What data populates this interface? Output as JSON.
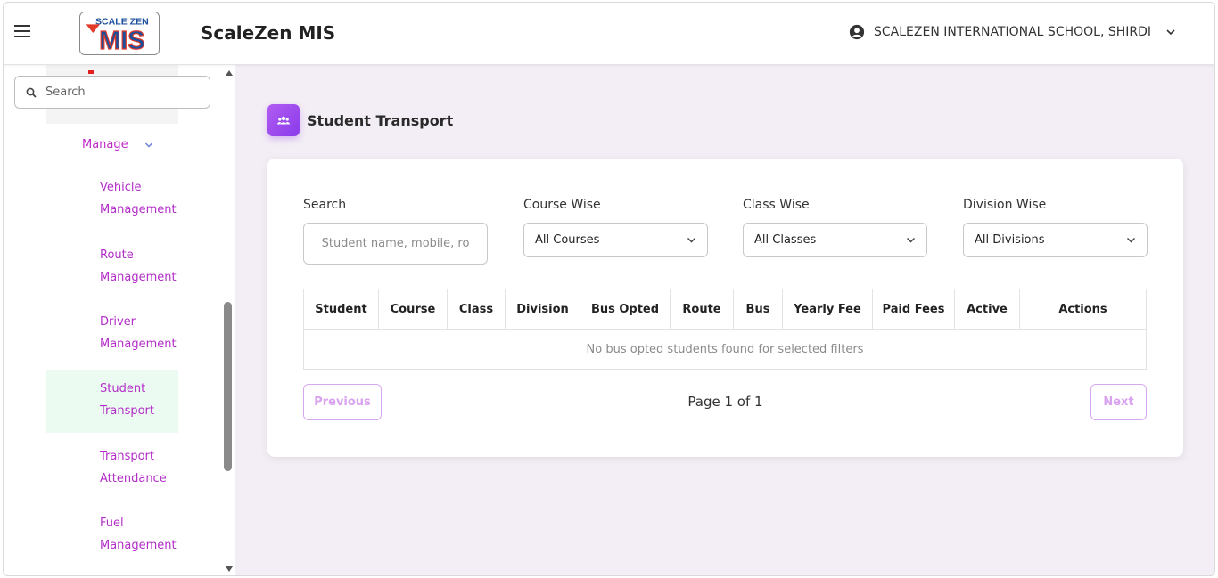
{
  "header": {
    "logo_top": "SCALE ZEN",
    "logo_main": "MIS",
    "app_title": "ScaleZen MIS",
    "school_name": "SCALEZEN INTERNATIONAL SCHOOL, SHIRDI"
  },
  "sidebar": {
    "search_placeholder": "Search",
    "manage_label": "Manage",
    "items": [
      {
        "line1": "Vehicle",
        "line2": "Management"
      },
      {
        "line1": "Route",
        "line2": "Management"
      },
      {
        "line1": "Driver",
        "line2": "Management"
      },
      {
        "line1": "Student",
        "line2": "Transport",
        "active": true
      },
      {
        "line1": "Transport",
        "line2": "Attendance"
      },
      {
        "line1": "Fuel",
        "line2": "Management"
      }
    ]
  },
  "main": {
    "page_title": "Student Transport",
    "filters": {
      "search_label": "Search",
      "search_placeholder": "Student name, mobile, ro",
      "course_label": "Course Wise",
      "course_value": "All Courses",
      "class_label": "Class Wise",
      "class_value": "All Classes",
      "division_label": "Division Wise",
      "division_value": "All Divisions"
    },
    "table": {
      "columns": [
        "Student",
        "Course",
        "Class",
        "Division",
        "Bus Opted",
        "Route",
        "Bus",
        "Yearly Fee",
        "Paid Fees",
        "Active",
        "Actions"
      ],
      "empty_message": "No bus opted students found for selected filters"
    },
    "pagination": {
      "previous": "Previous",
      "page_info": "Page 1 of 1",
      "next": "Next"
    }
  },
  "colors": {
    "accent": "#b32dc8",
    "active_bg": "#ecfbf1",
    "page_bg": "#f3eef5"
  }
}
